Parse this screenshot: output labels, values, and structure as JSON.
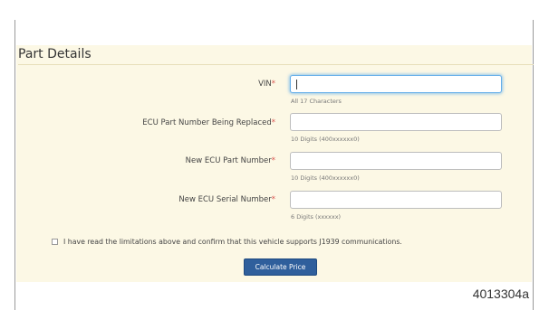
{
  "form": {
    "section_title": "Part Details",
    "required_marker": "*",
    "fields": [
      {
        "label": "VIN",
        "value": "",
        "hint": "All 17 Characters",
        "focused": true
      },
      {
        "label": "ECU Part Number Being Replaced",
        "value": "",
        "hint": "10 Digits (400xxxxxx0)",
        "focused": false
      },
      {
        "label": "New ECU Part Number",
        "value": "",
        "hint": "10 Digits (400xxxxxx0)",
        "focused": false
      },
      {
        "label": "New ECU Serial Number",
        "value": "",
        "hint": "6 Digits (xxxxxx)",
        "focused": false
      }
    ],
    "confirm_text": "I have read the limitations above and confirm that this vehicle supports J1939 communications.",
    "confirm_checked": false,
    "submit_label": "Calculate Price"
  },
  "figure_id": "4013304a",
  "colors": {
    "panel_bg": "#fcf8e5",
    "required": "#d9534f",
    "button_bg": "#2f5f9c",
    "focus_ring": "#66afe9"
  }
}
